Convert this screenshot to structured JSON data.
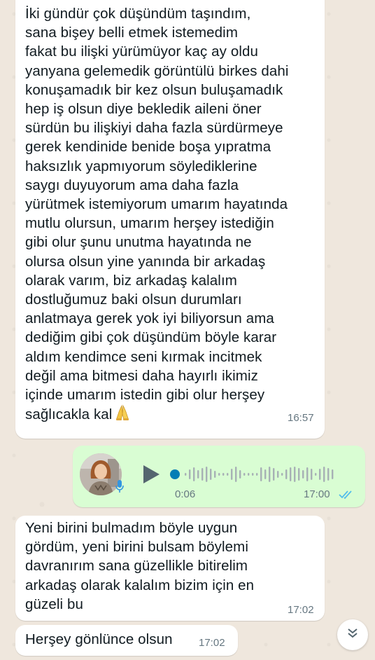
{
  "chat": {
    "messages": [
      {
        "direction": "incoming",
        "text": "İki gündür çok düşündüm taşındım,\nsana bişey belli etmek istemedim\nfakat bu ilişki yürümüyor kaç ay oldu\nyanyana gelemedik görüntülü birkes dahi\nkonuşamadık bir kez olsun buluşamadık\nhep iş olsun diye bekledik aileni öner\nsürdün bu ilişkiyi daha fazla sürdürmeye\ngerek kendinide benide boşa yıpratma\nhaksızlık yapmıyorum söylediklerine\nsaygı duyuyorum ama daha fazla\nyürütmek istemiyorum umarım hayatında\nmutlu olursun, umarım herşey istediğin\ngibi olur şunu unutma hayatında ne\nolursa olsun yine yanında bir arkadaş\nolarak varım, biz arkadaş kalalım\ndostluğumuz baki olsun durumları\nanlatmaya gerek yok iyi biliyorsun ama\ndediğim gibi çok düşündüm böyle karar\naldım kendimce seni kırmak incitmek\ndeğil ama bitmesi daha hayırlı ikimiz\niçinde umarım istedin gibi olur herşey\nsağlıcakla kal",
        "emoji": "folded-hands-emoji",
        "time": "16:57"
      },
      {
        "direction": "outgoing",
        "type": "voice",
        "duration": "0:06",
        "time": "17:00",
        "status": "read",
        "progress": 0.0
      },
      {
        "direction": "incoming",
        "text": "Yeni birini bulmadım böyle uygun\ngördüm, yeni birini bulsam böylemi\ndavranırım sana güzellikle bitirelim\narkadaş olarak kalalım bizim için en\ngüzeli bu",
        "time": "17:02"
      },
      {
        "direction": "incoming",
        "text": "Herşey gönlünce olsun",
        "time": "17:02"
      }
    ]
  },
  "colors": {
    "incoming_bubble": "#ffffff",
    "outgoing_bubble": "#d9fdd3",
    "read_ticks": "#53bdeb",
    "voice_accent": "#027eb5"
  },
  "icons": {
    "scroll_down": "double-chevron-down-icon",
    "play": "play-icon",
    "mic": "mic-icon"
  }
}
